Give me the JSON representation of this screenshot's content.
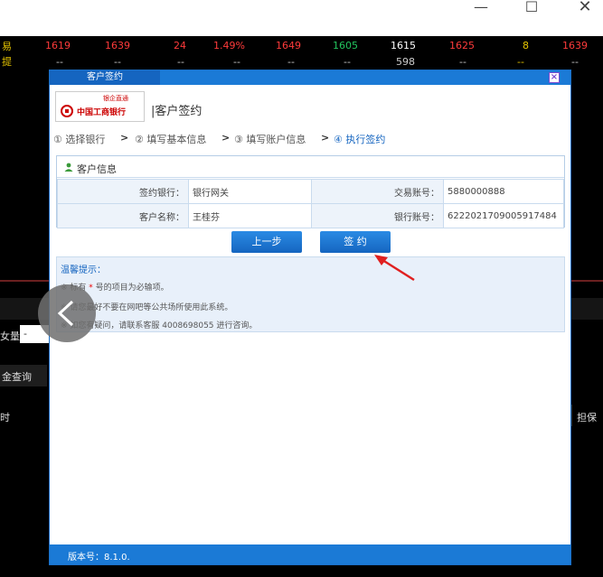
{
  "window": {
    "minimize_icon": "—",
    "maximize_icon": "☐",
    "close_icon": "✕"
  },
  "quotes": {
    "label_top": "易",
    "label_bottom": "提",
    "row1": [
      "1619",
      "1639",
      "24",
      "1.49%",
      "1649",
      "1605",
      "1615",
      "1625",
      "8",
      "1639"
    ],
    "row2": [
      "--",
      "--",
      "--",
      "--",
      "--",
      "--",
      "598",
      "--",
      "--",
      "--"
    ]
  },
  "background": {
    "qty_label": "女量",
    "qty_value": "-",
    "query_label": "金查询",
    "left_col": "时",
    "right_col": "担保"
  },
  "dialog": {
    "tab_title": "客户签约",
    "close_label": "×",
    "logo_name": "中国工商银行",
    "logo_sub": "银企直通",
    "heading": "|客户签约",
    "steps": [
      {
        "label": "① 选择银行"
      },
      {
        "label": "② 填写基本信息"
      },
      {
        "label": "③ 填写账户信息"
      },
      {
        "label": "④ 执行签约"
      }
    ],
    "step_arrow": ">",
    "info": {
      "title": "客户信息",
      "bank_label": "签约银行：",
      "bank_value": "银行网关",
      "trade_no_label": "交易账号：",
      "trade_no_value": "5880000888",
      "name_label": "客户名称：",
      "name_value": "王桂芬",
      "bank_acct_label": "银行账号：",
      "bank_acct_value": "6222021709005917484"
    },
    "buttons": {
      "prev": "上一步",
      "sign": "签 约"
    },
    "hint": {
      "title": "温馨提示：",
      "line1_prefix": "※ 标有",
      "line1_star": "*",
      "line1_suffix": "号的项目为必输项。",
      "line2": "※ 请您最好不要在网吧等公共场所使用此系统。",
      "line3": "※ 如您有疑问，请联系客服 4008698055 进行咨询。"
    },
    "version": "版本号：8.1.0."
  },
  "colors": {
    "accent": "#1b7ad6",
    "quote_red": "#ff3b3b",
    "quote_green": "#22c55e",
    "quote_yellow": "#e5c400",
    "annotation_red": "#e02020"
  }
}
